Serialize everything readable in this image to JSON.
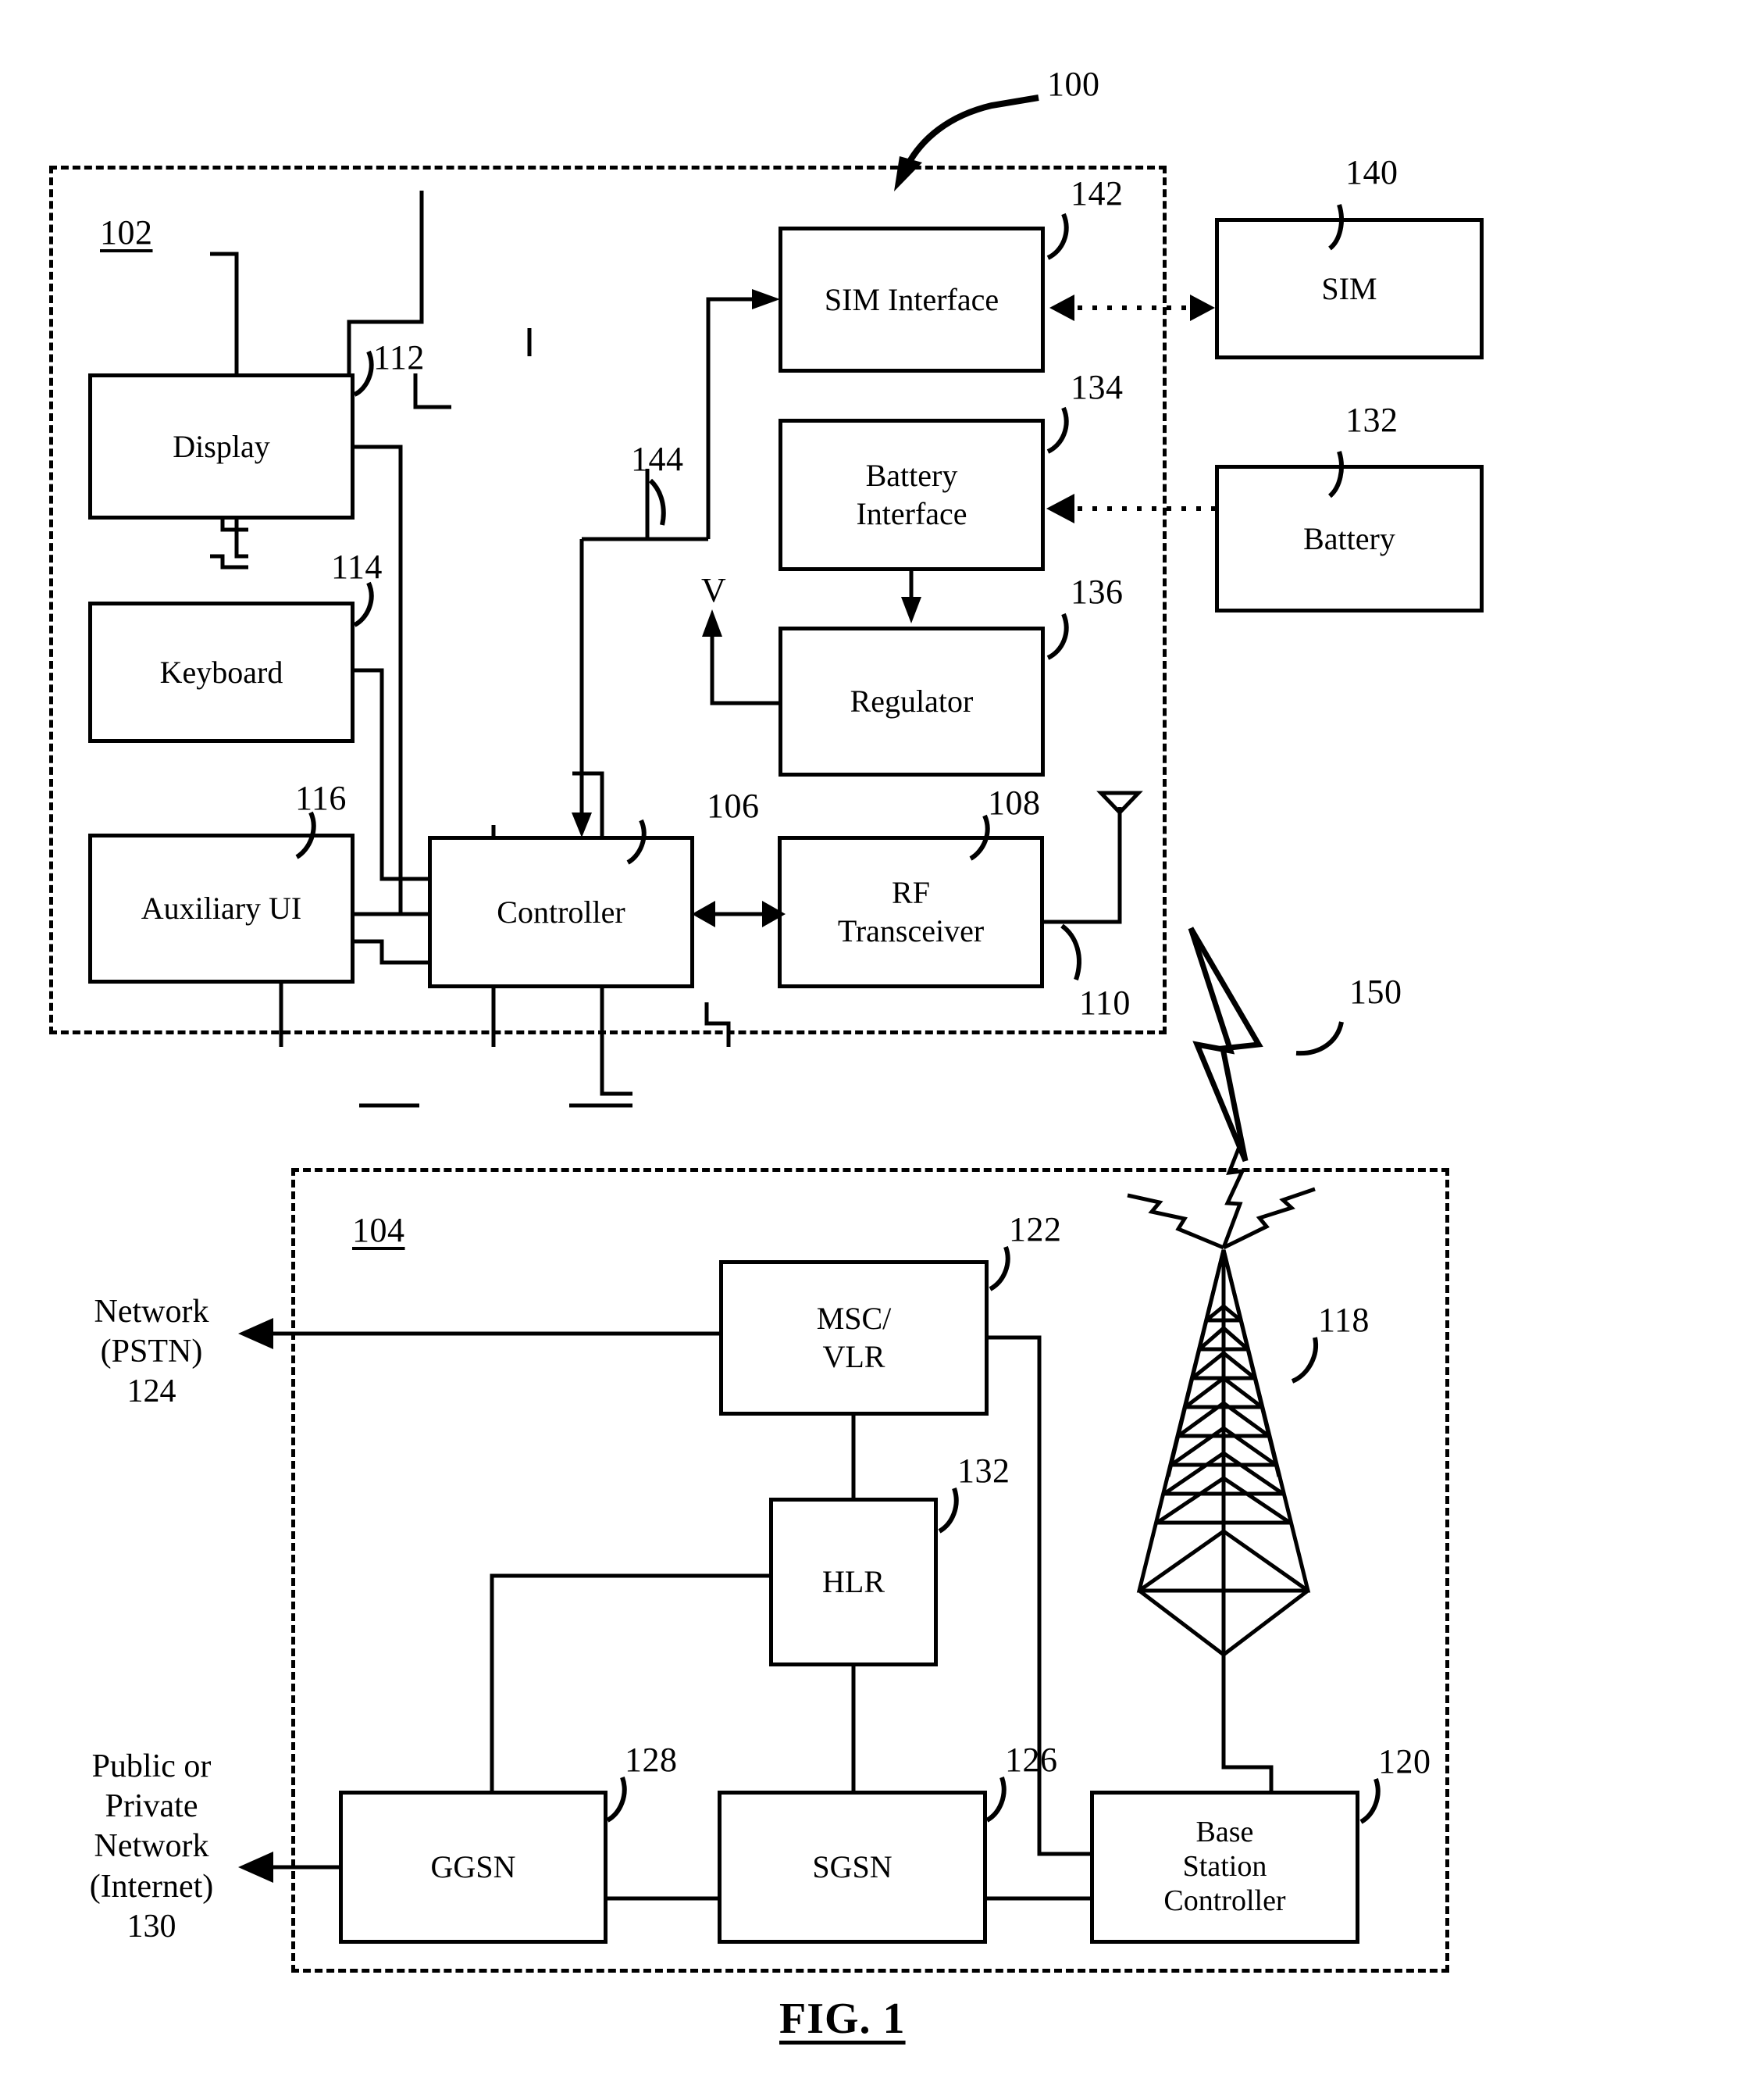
{
  "figure": {
    "caption": "FIG. 1",
    "top_ref": "100",
    "link_ref": "150"
  },
  "mobile_device": {
    "enclosure_ref": "102",
    "blocks": [
      {
        "id": "display",
        "label": "Display",
        "ref": "112"
      },
      {
        "id": "keyboard",
        "label": "Keyboard",
        "ref": "114"
      },
      {
        "id": "auxiliary-ui",
        "label": "Auxiliary UI",
        "ref": "116"
      },
      {
        "id": "controller",
        "label": "Controller",
        "ref": "106"
      },
      {
        "id": "rf-transceiver",
        "label": "RF\nTransceiver",
        "ref": "108"
      },
      {
        "id": "sim-interface",
        "label": "SIM Interface",
        "ref": "142"
      },
      {
        "id": "battery-interface",
        "label": "Battery\nInterface",
        "ref": "134"
      },
      {
        "id": "regulator",
        "label": "Regulator",
        "ref": "136"
      }
    ],
    "antenna_ref": "110",
    "controller_bus_ref": "144",
    "voltage_label": "V"
  },
  "external_modules": [
    {
      "id": "sim",
      "label": "SIM",
      "ref": "140"
    },
    {
      "id": "battery",
      "label": "Battery",
      "ref": "132"
    }
  ],
  "network": {
    "enclosure_ref": "104",
    "blocks": [
      {
        "id": "msc-vlr",
        "label": "MSC/\nVLR",
        "ref": "122"
      },
      {
        "id": "hlr",
        "label": "HLR",
        "ref": "132"
      },
      {
        "id": "ggsn",
        "label": "GGSN",
        "ref": "128"
      },
      {
        "id": "sgsn",
        "label": "SGSN",
        "ref": "126"
      },
      {
        "id": "base-station-controller",
        "label": "Base\nStation\nController",
        "ref": "120"
      }
    ],
    "tower_ref": "118",
    "pstn_label": "Network\n(PSTN)\n124",
    "internet_label": "Public or\nPrivate\nNetwork\n(Internet)\n130"
  },
  "colors": {
    "ink": "#000000",
    "paper": "#ffffff"
  }
}
